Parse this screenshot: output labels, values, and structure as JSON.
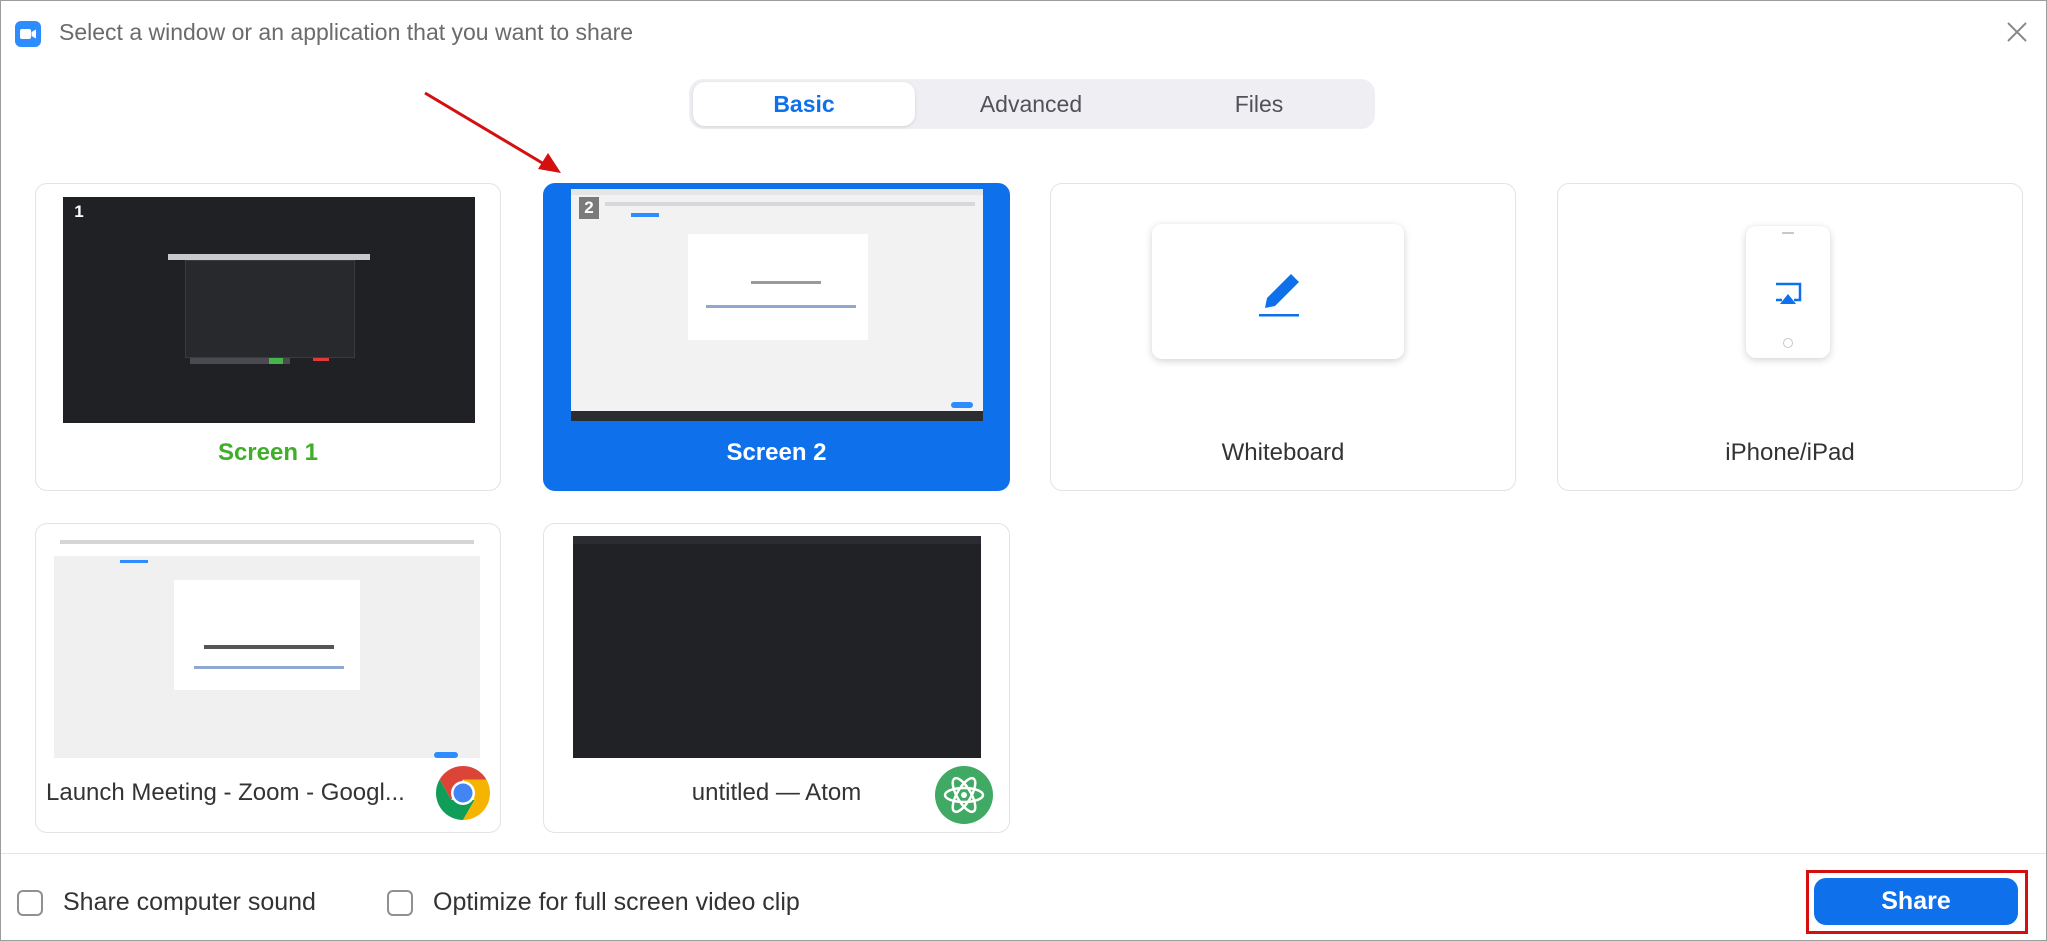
{
  "window": {
    "title": "Select a window or an application that you want to share"
  },
  "tabs": [
    {
      "label": "Basic",
      "active": true
    },
    {
      "label": "Advanced",
      "active": false
    },
    {
      "label": "Files",
      "active": false
    }
  ],
  "cards": {
    "screen1": {
      "label": "Screen 1",
      "number": "1"
    },
    "screen2": {
      "label": "Screen 2",
      "number": "2",
      "selected": true
    },
    "whiteboard": {
      "label": "Whiteboard"
    },
    "iphone": {
      "label": "iPhone/iPad"
    },
    "chrome_window": {
      "label": "Launch Meeting - Zoom - Googl..."
    },
    "atom_window": {
      "label": "untitled — Atom"
    }
  },
  "options": {
    "share_sound": {
      "label": "Share computer sound",
      "checked": false
    },
    "optimize_video": {
      "label": "Optimize for full screen video clip",
      "checked": false
    }
  },
  "actions": {
    "share_label": "Share"
  },
  "colors": {
    "accent": "#0e71eb",
    "screen1_label": "#3fae29",
    "annotation_red": "#d40f0f"
  },
  "icons": [
    "zoom-app-icon",
    "close-icon",
    "pen-icon",
    "airplay-icon",
    "chrome-icon",
    "atom-icon",
    "annotation-arrow"
  ]
}
